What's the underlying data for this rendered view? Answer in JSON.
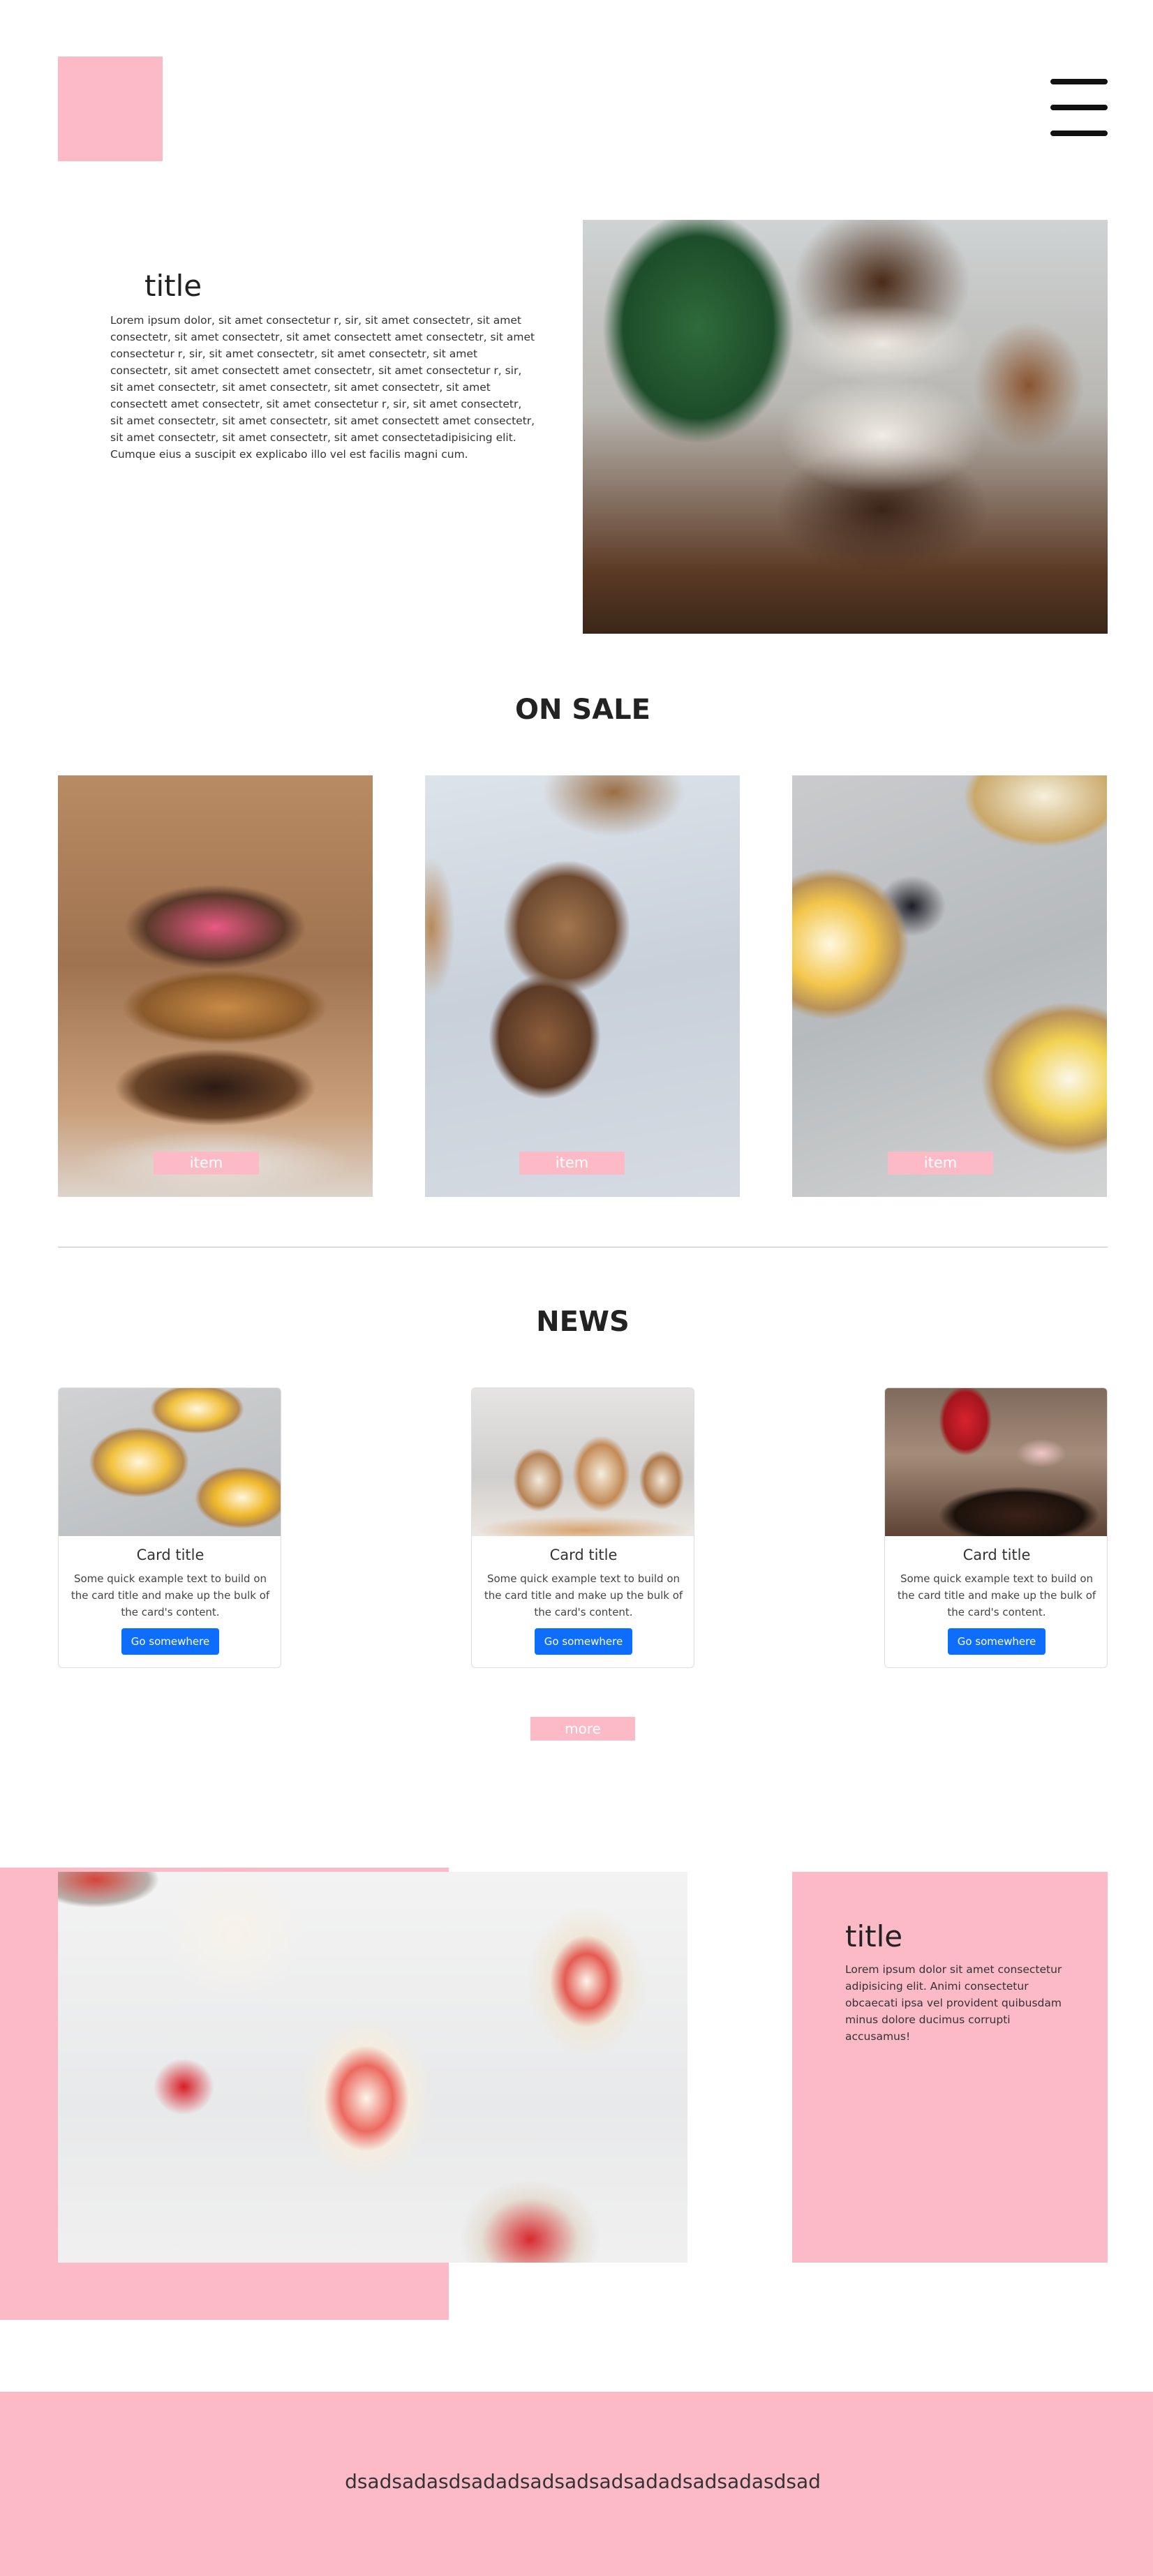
{
  "header": {
    "logo_color": "#fbbac6",
    "menu_icon": "hamburger-menu-icon"
  },
  "intro": {
    "title": "title",
    "text": "Lorem ipsum dolor, sit amet consectetur r, sir, sit amet consectetr, sit amet consectetr, sit amet consectetr, sit amet consectett amet consectetr, sit amet consectetur r, sir, sit amet consectetr, sit amet consectetr, sit amet consectetr, sit amet consectett amet consectetr, sit amet consectetur r, sir, sit amet consectetr, sit amet consectetr, sit amet consectetr, sit amet consectett amet consectetr, sit amet consectetur r, sir, sit amet consectetr, sit amet consectetr, sit amet consectetr, sit amet consectett amet consectetr, sit amet consectetr, sit amet consectetr, sit amet consectetadipisicing elit. Cumque eius a suscipit ex explicabo illo vel est facilis magni cum.",
    "image": "chocolate-parfait-photo"
  },
  "on_sale": {
    "title": "ON SALE",
    "items": [
      {
        "label": "item",
        "image": "donuts-photo"
      },
      {
        "label": "item",
        "image": "cookies-photo"
      },
      {
        "label": "item",
        "image": "fruit-tarts-photo"
      }
    ]
  },
  "news": {
    "title": "NEWS",
    "cards": [
      {
        "title": "Card title",
        "text": "Some quick example text to build on the card title and make up the bulk of the card's content.",
        "button": "Go somewhere",
        "image": "tarts-photo"
      },
      {
        "title": "Card title",
        "text": "Some quick example text to build on the card title and make up the bulk of the card's content.",
        "button": "Go somewhere",
        "image": "cupcakes-photo"
      },
      {
        "title": "Card title",
        "text": "Some quick example text to build on the card title and make up the bulk of the card's content.",
        "button": "Go somewhere",
        "image": "cake-and-drink-photo"
      }
    ],
    "more_label": "more",
    "button_color": "#0d6efd"
  },
  "feature": {
    "title": "title",
    "text": "Lorem ipsum dolor sit amet consectetur adipisicing elit. Animi consectetur obcaecati ipsa vel provident quibusdam minus dolore ducimus corrupti accusamus!",
    "image": "strawberry-panna-cotta-photo"
  },
  "footer": {
    "text": "dsadsadasdsadadsadsadsadsadadsadsadasdsad"
  },
  "colors": {
    "accent_pink": "#fbbac6",
    "primary_blue": "#0d6efd"
  }
}
